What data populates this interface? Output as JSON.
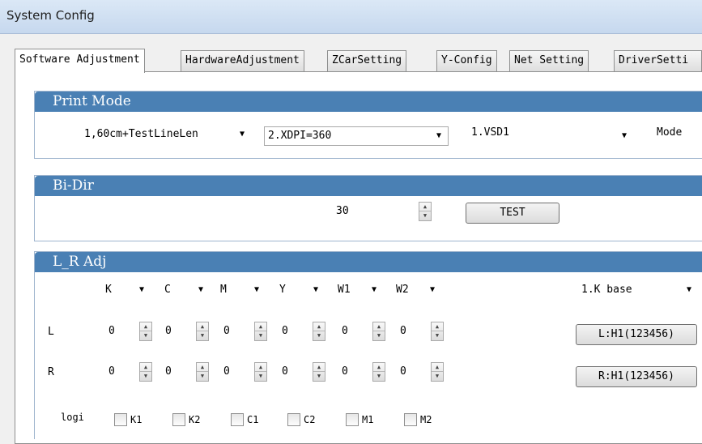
{
  "window": {
    "title": "System Config"
  },
  "tabs": [
    "Software Adjustment",
    "HardwareAdjustment",
    "ZCarSetting",
    "Y-Config",
    "Net Setting",
    "DriverSetti"
  ],
  "print_mode": {
    "header": "Print Mode",
    "combo1": "1,60cm+TestLineLen",
    "combo2": "2.XDPI=360",
    "combo3": "1.VSD1",
    "mode_label": "Mode"
  },
  "bi_dir": {
    "header": "Bi-Dir",
    "value": "30",
    "test_button": "TEST"
  },
  "lr_adj": {
    "header": "L_R Adj",
    "color_combos": [
      "K",
      "C",
      "M",
      "Y",
      "W1",
      "W2"
    ],
    "base_combo": "1.K base",
    "row_l_label": "L",
    "row_r_label": "R",
    "l_values": [
      "0",
      "0",
      "0",
      "0",
      "0",
      "0"
    ],
    "r_values": [
      "0",
      "0",
      "0",
      "0",
      "0",
      "0"
    ],
    "l_button": "L:H1(123456)",
    "r_button": "R:H1(123456)",
    "logic_label": "logi",
    "logic_checks": [
      "K1",
      "K2",
      "C1",
      "C2",
      "M1",
      "M2"
    ]
  },
  "icons": {
    "dropdown": "chevron-down-icon",
    "spin_up": "spin-up-icon",
    "spin_down": "spin-down-icon"
  }
}
